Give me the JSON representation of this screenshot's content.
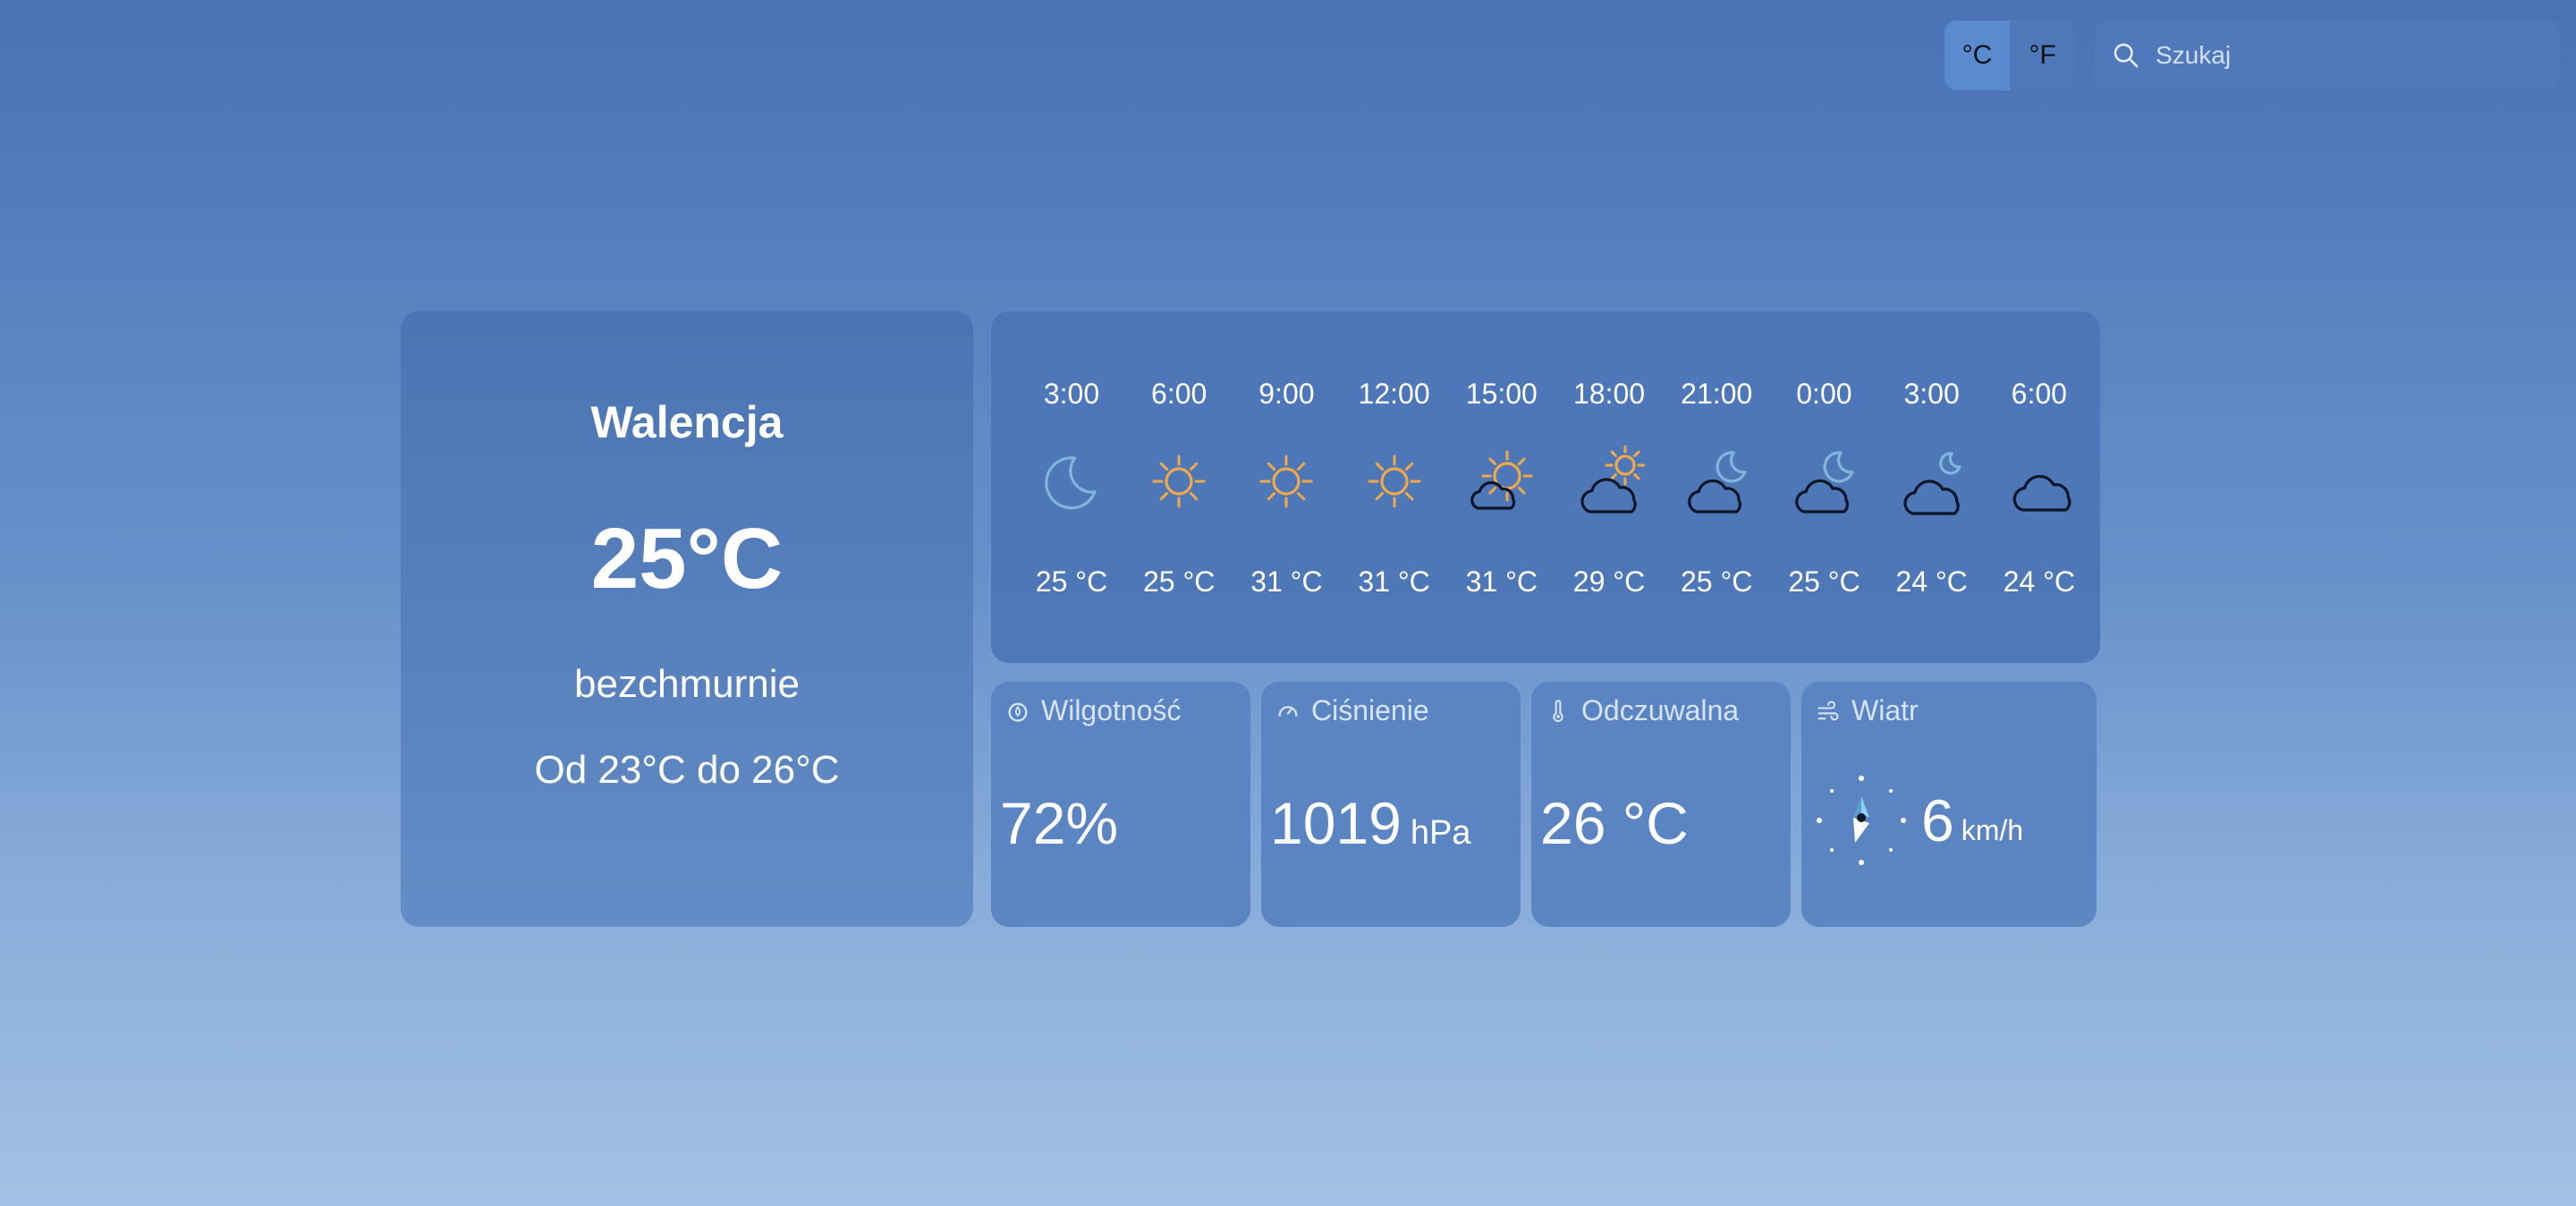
{
  "units": {
    "celsius": "°C",
    "fahrenheit": "°F",
    "selected": "celsius"
  },
  "search": {
    "placeholder": "Szukaj"
  },
  "current": {
    "city": "Walencja",
    "temperature": "25°C",
    "condition": "bezchmurnie",
    "range": "Od 23°C do 26°C"
  },
  "forecast": [
    {
      "time": "3:00",
      "temp": "25 °C",
      "icon": "moon-icon"
    },
    {
      "time": "6:00",
      "temp": "25 °C",
      "icon": "sun-icon"
    },
    {
      "time": "9:00",
      "temp": "31 °C",
      "icon": "sun-icon"
    },
    {
      "time": "12:00",
      "temp": "31 °C",
      "icon": "sun-icon"
    },
    {
      "time": "15:00",
      "temp": "31 °C",
      "icon": "sun-small-cloud-icon"
    },
    {
      "time": "18:00",
      "temp": "29 °C",
      "icon": "cloud-sun-icon"
    },
    {
      "time": "21:00",
      "temp": "25 °C",
      "icon": "cloud-moon-icon"
    },
    {
      "time": "0:00",
      "temp": "25 °C",
      "icon": "cloud-moon-icon"
    },
    {
      "time": "3:00",
      "temp": "24 °C",
      "icon": "cloud-small-moon-icon"
    },
    {
      "time": "6:00",
      "temp": "24 °C",
      "icon": "cloud-icon"
    }
  ],
  "stats": {
    "humidity": {
      "label": "Wilgotność",
      "value": "72%"
    },
    "pressure": {
      "label": "Ciśnienie",
      "value": "1019",
      "unit": "hPa"
    },
    "feels_like": {
      "label": "Odczuwalna",
      "value": "26 °C"
    },
    "wind": {
      "label": "Wiatr",
      "value": "6",
      "unit": "km/h"
    }
  },
  "colors": {
    "sun": "#f0a94a",
    "moon": "#7fb6d9",
    "cloud_stroke": "#0d1526",
    "accent_toggle": "#5a8ad0"
  }
}
